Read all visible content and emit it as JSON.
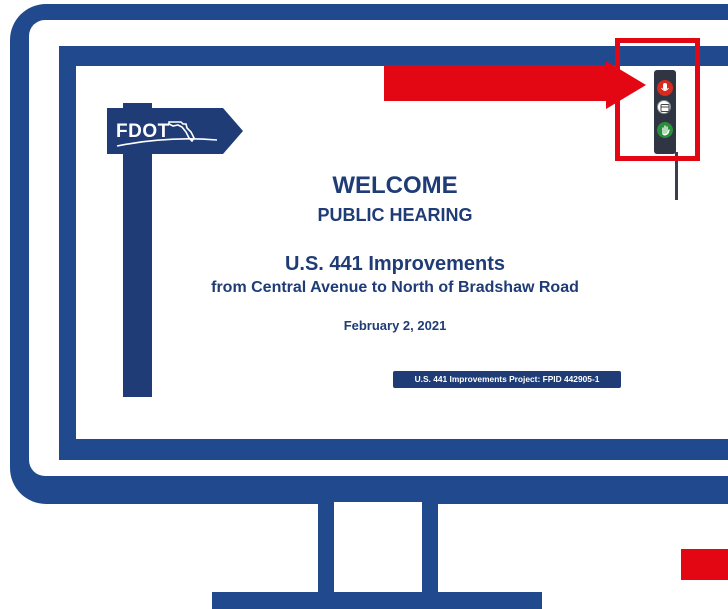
{
  "colors": {
    "brand_navy": "#1f3c76",
    "monitor_blue": "#214a8e",
    "callout_red": "#e30613"
  },
  "sign": {
    "logo_text": "FDOT",
    "icon": "florida-map-icon"
  },
  "slide": {
    "title": "WELCOME",
    "subtitle": "PUBLIC HEARING",
    "project": "U.S. 441 Improvements",
    "limits": "from Central Avenue to North of Bradshaw Road",
    "date": "February 2, 2021",
    "fpid_label": "U.S. 441 Improvements Project: FPID 442905-1"
  },
  "toolbar": {
    "buttons": [
      {
        "icon": "microphone-icon"
      },
      {
        "icon": "chat-icon"
      },
      {
        "icon": "raise-hand-icon"
      }
    ]
  }
}
